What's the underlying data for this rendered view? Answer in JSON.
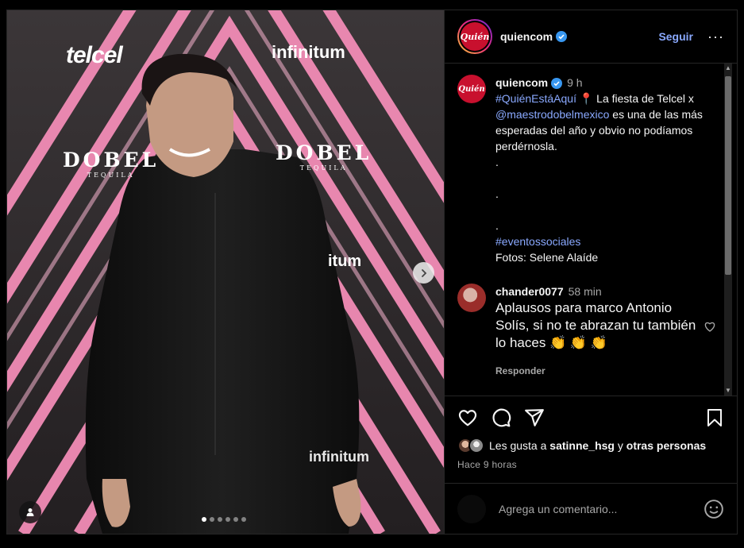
{
  "media": {
    "backdrop_logos": {
      "telcel": "telcel",
      "infinitum": "infinitum",
      "dobel": "DOBEL",
      "tequila": "TEQUILA"
    },
    "carousel_dots_count": 6,
    "active_dot": 0,
    "icons": {
      "next": "chevron-right-icon",
      "user_tag": "user-icon"
    }
  },
  "header": {
    "avatar_text": "Quién",
    "username": "quiencom",
    "verified": true,
    "follow_label": "Seguir",
    "more_label": "···"
  },
  "caption": {
    "username": "quiencom",
    "time": "9 h",
    "hashtag1": "#QuiénEstáAquí",
    "pin_emoji": "📍",
    "text1": " La fiesta de Telcel x",
    "mention": "@maestrodobelmexico",
    "text2": " es una de las más esperadas del año y obvio no podíamos perdérnosla.",
    "dot1": ".",
    "dot2": ".",
    "dot3": ".",
    "hashtag2": "#eventossociales",
    "credit": "Fotos: Selene Alaíde"
  },
  "comment": {
    "username": "chander0077",
    "time": "58 min",
    "text": "Aplausos para marco Antonio Solís, si no te abrazan tu también lo haces 👏 👏 👏",
    "reply_label": "Responder"
  },
  "actions": {
    "icons": [
      "heart-icon",
      "comment-icon",
      "share-icon",
      "bookmark-icon"
    ],
    "likes_prefix": "Les gusta a ",
    "likes_user": "satinne_hsg",
    "likes_mid": " y ",
    "likes_others": "otras personas",
    "post_age": "Hace 9 horas"
  },
  "add_comment": {
    "placeholder": "Agrega un comentario...",
    "emoji_icon": "emoji-icon"
  },
  "colors": {
    "link_blue": "#8aa9ff",
    "brand_red": "#c8102e",
    "stripe_pink": "#f28cb6",
    "background": "#000000"
  }
}
